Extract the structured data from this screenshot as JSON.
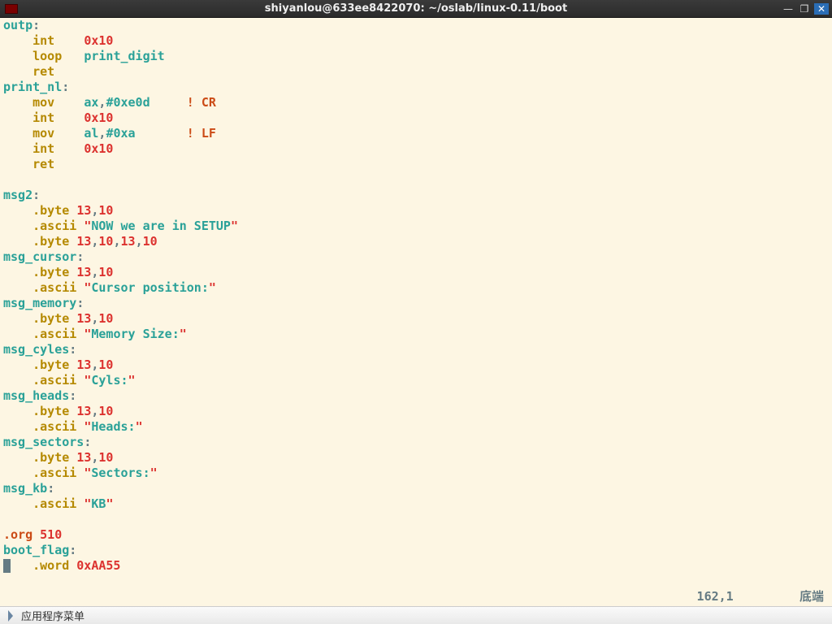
{
  "window": {
    "title": "shiyanlou@633ee8422070: ~/oslab/linux-0.11/boot"
  },
  "code": {
    "l01_label": "outp",
    "l02_op": "int",
    "l02_arg": "0x10",
    "l03_op": "loop",
    "l03_arg": "print_digit",
    "l04_op": "ret",
    "l05_label": "print_nl",
    "l06_op": "mov",
    "l06_arg1": "ax",
    "l06_arg2": "#0xe0d",
    "l06_cmt": "! CR",
    "l07_op": "int",
    "l07_arg": "0x10",
    "l08_op": "mov",
    "l08_arg1": "al",
    "l08_arg2": "#0xa",
    "l08_cmt": "! LF",
    "l09_op": "int",
    "l09_arg": "0x10",
    "l10_op": "ret",
    "l12_label": "msg2",
    "l13_dir": ".byte",
    "l13_arg": "13",
    "l13_arg2": "10",
    "l14_dir": ".ascii",
    "l14_str": "NOW we are in SETUP",
    "l15_dir": ".byte",
    "l15_arg": "13,10,13,10",
    "l15_a": "13",
    "l15_b": "10",
    "l15_c": "13",
    "l15_d": "10",
    "l16_label": "msg_cursor",
    "l17_dir": ".byte",
    "l17_arg": "13",
    "l17_arg2": "10",
    "l18_dir": ".ascii",
    "l18_str": "Cursor position:",
    "l19_label": "msg_memory",
    "l20_dir": ".byte",
    "l20_arg": "13",
    "l20_arg2": "10",
    "l21_dir": ".ascii",
    "l21_str": "Memory Size:",
    "l22_label": "msg_cyles",
    "l23_dir": ".byte",
    "l23_arg": "13",
    "l23_arg2": "10",
    "l24_dir": ".ascii",
    "l24_str": "Cyls:",
    "l25_label": "msg_heads",
    "l26_dir": ".byte",
    "l26_arg": "13",
    "l26_arg2": "10",
    "l27_dir": ".ascii",
    "l27_str": "Heads:",
    "l28_label": "msg_sectors",
    "l29_dir": ".byte",
    "l29_arg": "13",
    "l29_arg2": "10",
    "l30_dir": ".ascii",
    "l30_str": "Sectors:",
    "l31_label": "msg_kb",
    "l32_dir": ".ascii",
    "l32_str": "KB",
    "l34_dir": ".org",
    "l34_arg": "510",
    "l35_label": "boot_flag",
    "l36_dir": ".word",
    "l36_arg": "0xAA55"
  },
  "status": {
    "pos": "162,1",
    "loc": "底端"
  },
  "taskbar": {
    "start": "应用程序菜单"
  }
}
